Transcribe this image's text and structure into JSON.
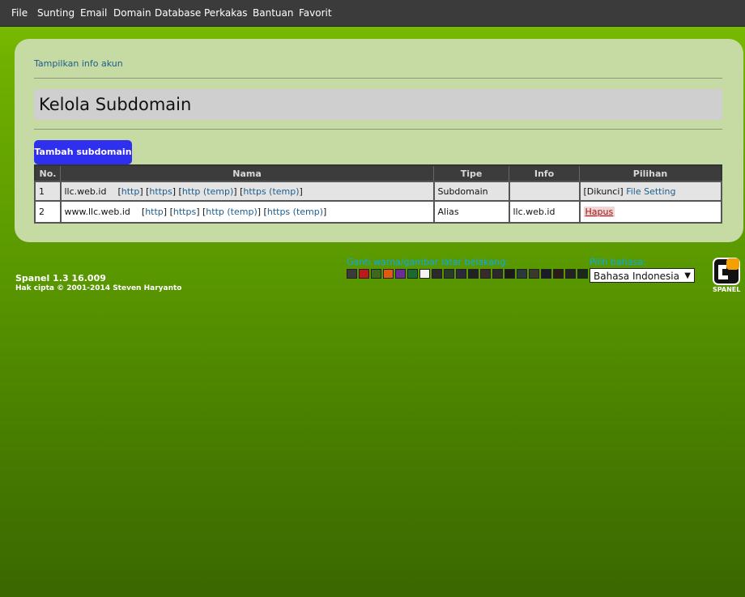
{
  "menubar": {
    "items": [
      "File",
      "Sunting",
      "Email",
      "Domain",
      "Database",
      "Perkakas",
      "Bantuan",
      "Favorit"
    ]
  },
  "panel": {
    "account_link": "Tampilkan info akun",
    "title": "Kelola Subdomain",
    "add_button": "Tambah subdomain",
    "table": {
      "headers": [
        "No.",
        "Nama",
        "Tipe",
        "Info",
        "Pilihan"
      ],
      "rows": [
        {
          "no": "1",
          "name": "llc.web.id",
          "links": [
            "http",
            "https",
            "http (temp)",
            "https (temp)"
          ],
          "type": "Subdomain",
          "info": "",
          "locked": "[Dikunci]",
          "action": "File Setting"
        },
        {
          "no": "2",
          "name": "www.llc.web.id",
          "links": [
            "http",
            "https",
            "http (temp)",
            "https (temp)"
          ],
          "type": "Alias",
          "info": "llc.web.id",
          "action": "Hapus"
        }
      ]
    }
  },
  "footer": {
    "version": "Spanel 1.3 16.009",
    "copyright": "Hak cipta © 2001-2014 Steven Haryanto",
    "color_label": "Ganti warna/gambar latar belakang:",
    "swatches": [
      "#3a3a3a",
      "#c01818",
      "#3a6a1a",
      "#e05a10",
      "#6a2a9a",
      "#1a6a30",
      "#f4f4f4",
      "#2a2a2a",
      "#2a3a2a",
      "#2a2a3a",
      "#222222",
      "#3a2a2a",
      "#2a2a2a",
      "#1a1a1a",
      "#2a3a3a",
      "#3a3a2a",
      "#1a1a2a",
      "#2a1a1a",
      "#222222",
      "#1a2a1a",
      "#3a2a1a",
      "#111111"
    ],
    "language_label": "Pilih bahasa:",
    "language_value": "Bahasa Indonesia",
    "logo_text": "SPANEL"
  }
}
